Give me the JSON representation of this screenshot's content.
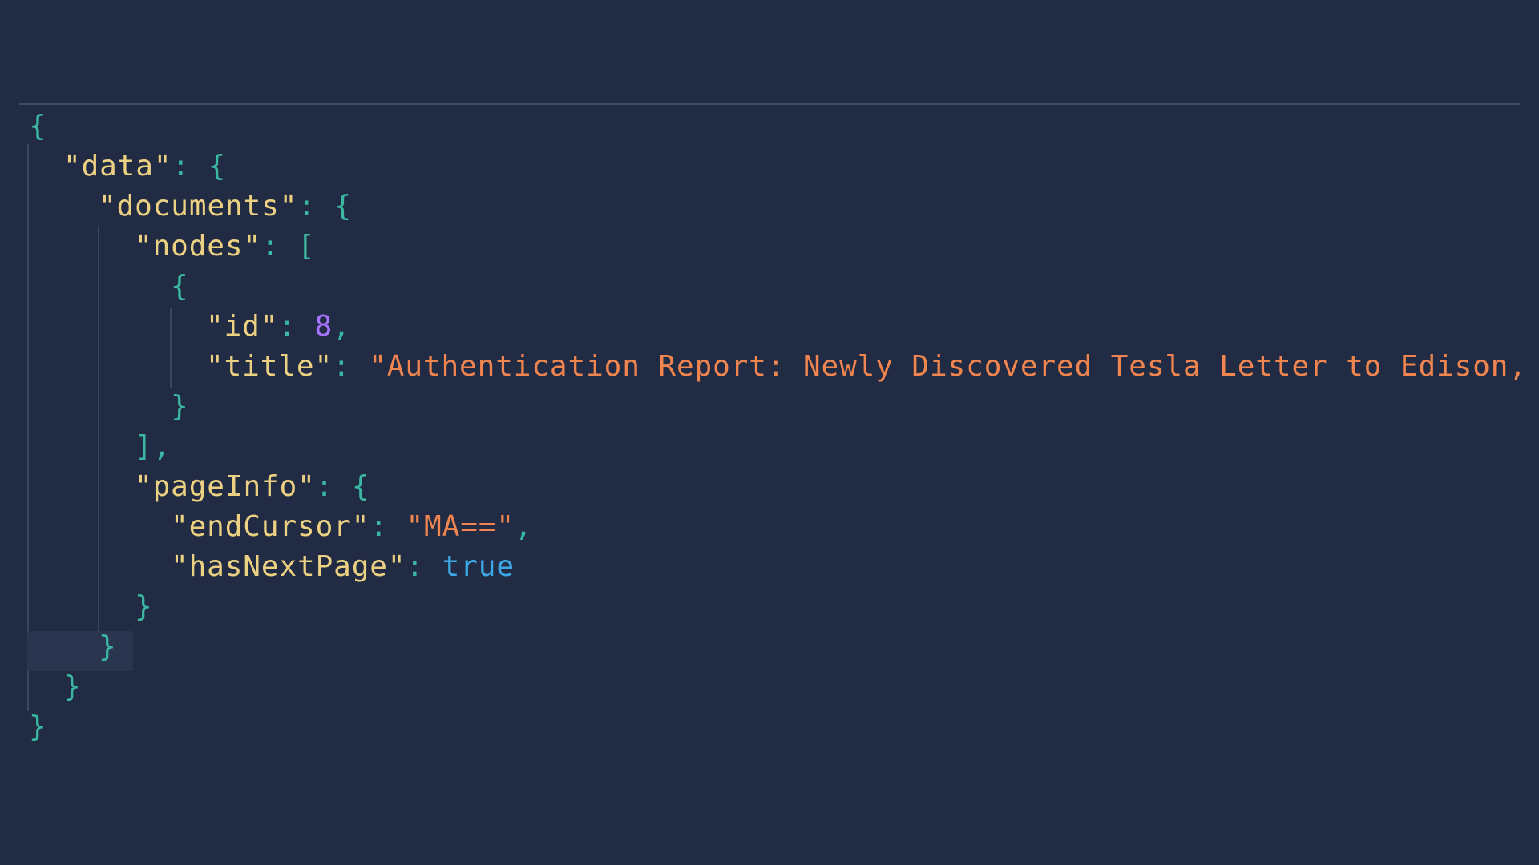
{
  "colors": {
    "background": "#212b43",
    "key": "#ecd182",
    "string": "#f0854f",
    "number": "#a774ff",
    "boolean": "#3ca8e6",
    "punctuation": "#3bb8a2"
  },
  "json_view": {
    "keys": {
      "data": "\"data\"",
      "documents": "\"documents\"",
      "nodes": "\"nodes\"",
      "id": "\"id\"",
      "title": "\"title\"",
      "pageInfo": "\"pageInfo\"",
      "endCursor": "\"endCursor\"",
      "hasNextPage": "\"hasNextPage\""
    },
    "values": {
      "id": "8",
      "title": "\"Authentication Report: Newly Discovered Tesla Letter to Edison,",
      "endCursor": "\"MA==\"",
      "hasNextPage": "true"
    }
  }
}
